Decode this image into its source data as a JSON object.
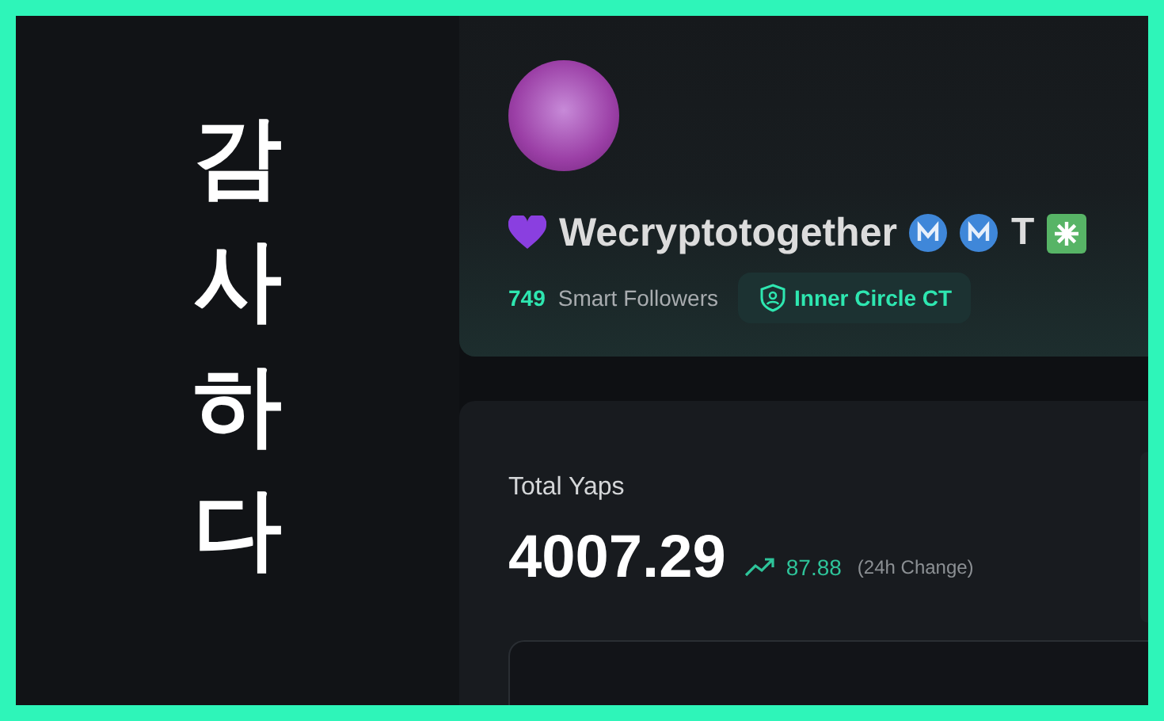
{
  "banner": {
    "text": "감사하다"
  },
  "profile": {
    "name": "Wecryptotogether",
    "name_suffix": "T",
    "smart_followers_count": "749",
    "smart_followers_label": "Smart Followers",
    "badge": "Inner Circle CT"
  },
  "yaps": {
    "title": "Total Yaps",
    "value": "4007.29",
    "change": "87.88",
    "change_label": "(24h Change)"
  }
}
